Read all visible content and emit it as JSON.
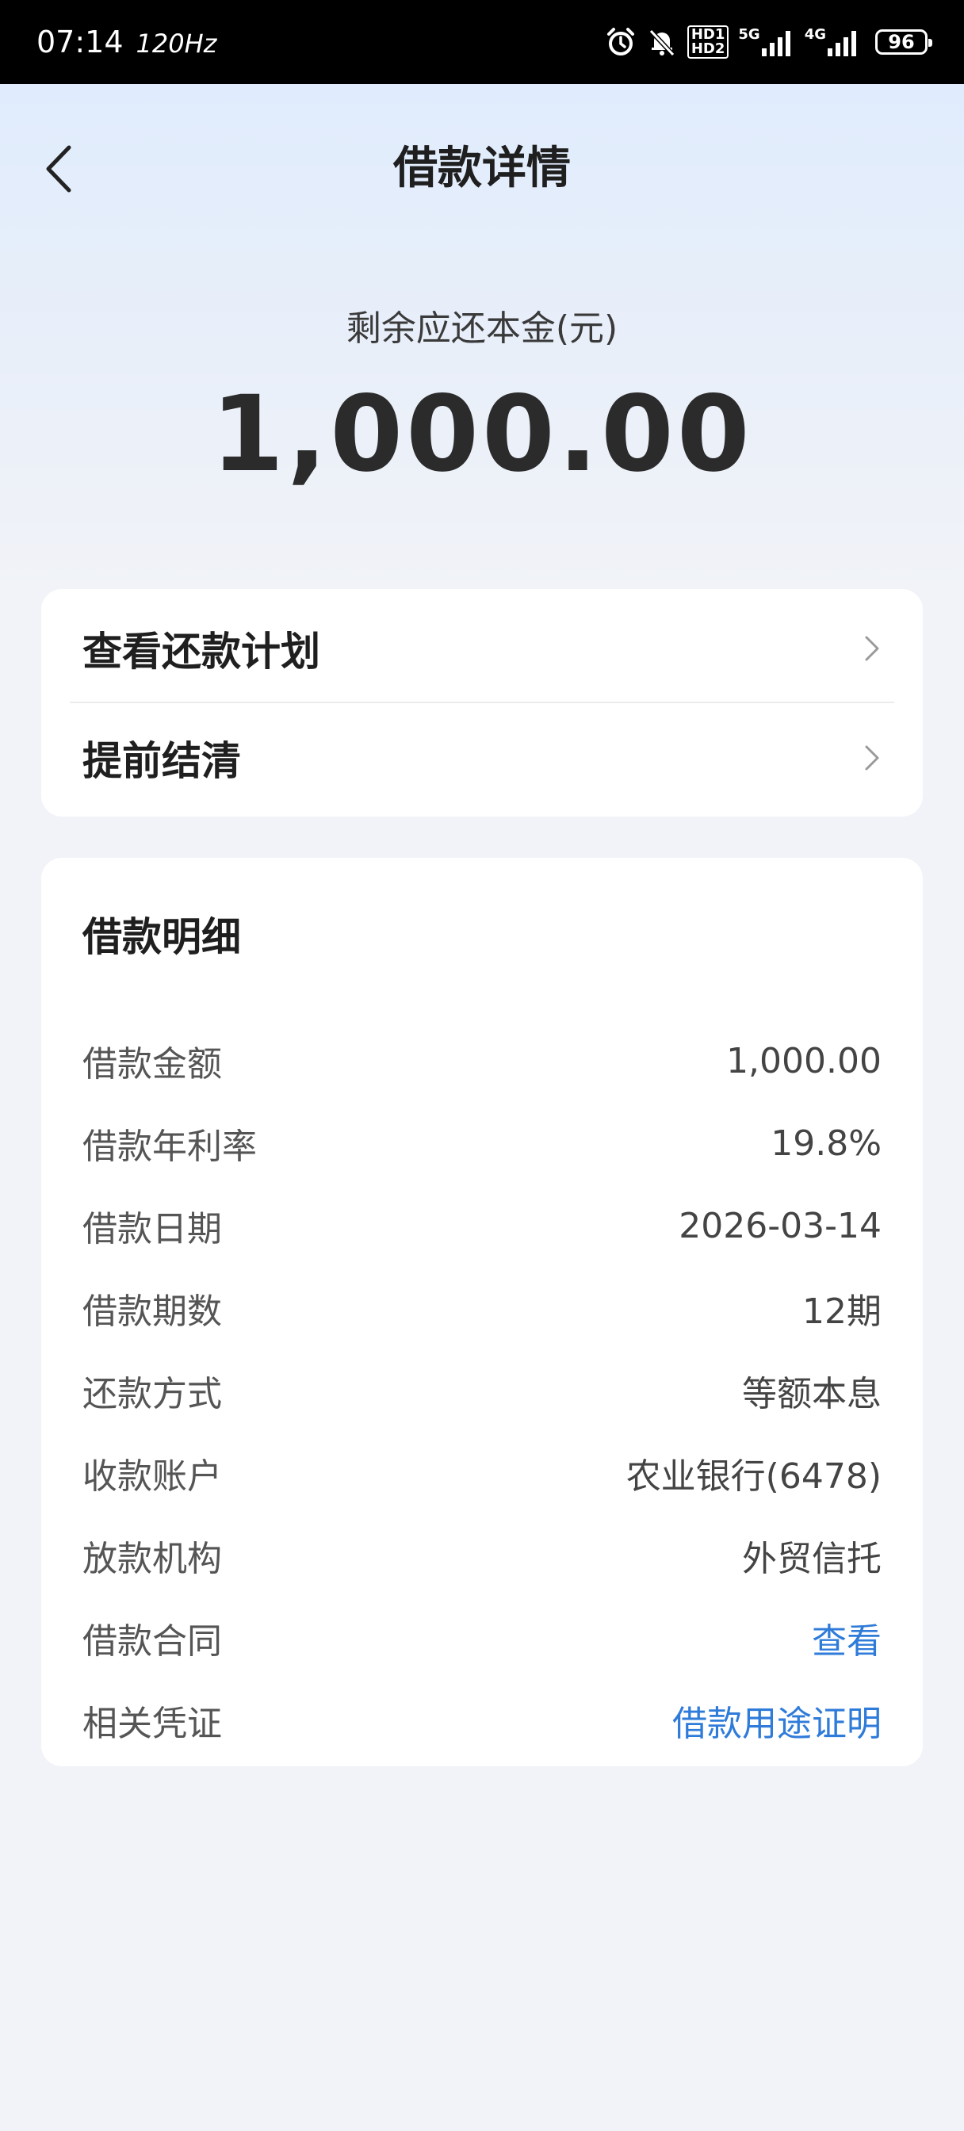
{
  "status_bar": {
    "time": "07:14",
    "refresh_rate": "120Hz",
    "hd1": "HD1",
    "hd2": "HD2",
    "net1": "5G",
    "net2": "4G",
    "battery": "96"
  },
  "nav": {
    "title": "借款详情"
  },
  "summary": {
    "label": "剩余应还本金(元)",
    "amount": "1,000.00"
  },
  "actions": [
    {
      "label": "查看还款计划"
    },
    {
      "label": "提前结清"
    }
  ],
  "details": {
    "title": "借款明细",
    "rows": [
      {
        "label": "借款金额",
        "value": "1,000.00"
      },
      {
        "label": "借款年利率",
        "value": "19.8%"
      },
      {
        "label": "借款日期",
        "value": "2026-03-14"
      },
      {
        "label": "借款期数",
        "value": "12期"
      },
      {
        "label": "还款方式",
        "value": "等额本息"
      },
      {
        "label": "收款账户",
        "value": "农业银行(6478)"
      },
      {
        "label": "放款机构",
        "value": "外贸信托"
      },
      {
        "label": "借款合同",
        "value": "查看"
      },
      {
        "label": "相关凭证",
        "value": "借款用途证明"
      }
    ]
  },
  "colors": {
    "link": "#2f7bd9",
    "header_gradient_top": "#e0ecfd",
    "page_background": "#f1f3f8"
  }
}
